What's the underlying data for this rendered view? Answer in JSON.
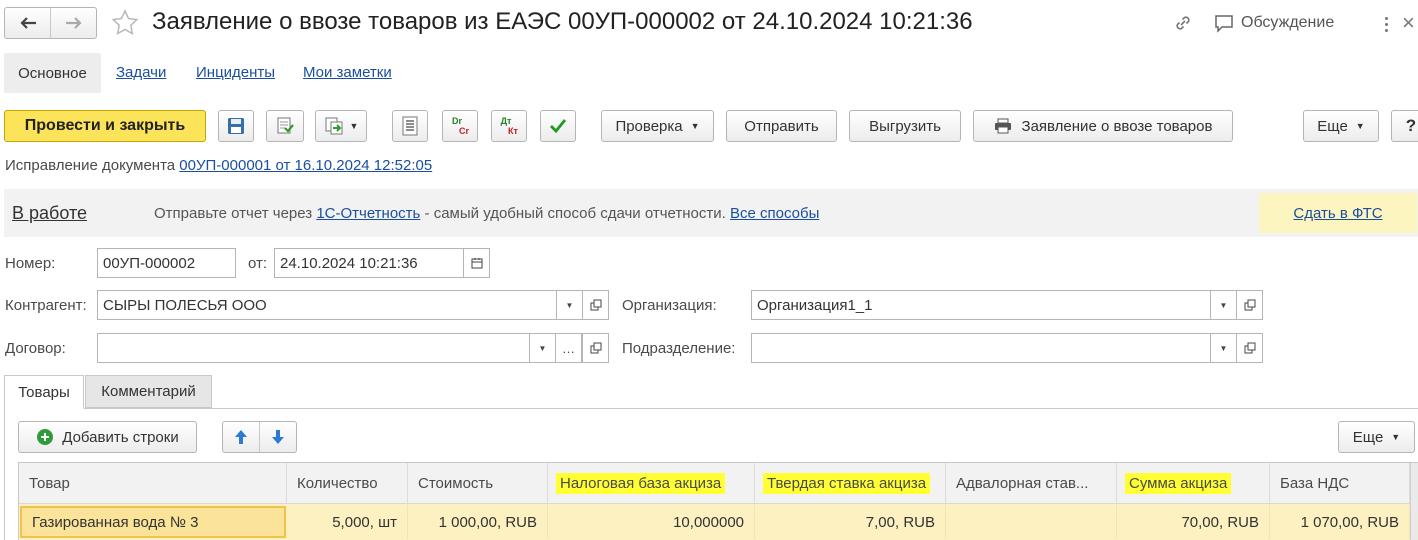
{
  "window": {
    "title": "Заявление о ввозе товаров из ЕАЭС 00УП-000002 от 24.10.2024 10:21:36",
    "discussion_label": "Обсуждение"
  },
  "nav_tabs": [
    {
      "label": "Основное"
    },
    {
      "label": "Задачи"
    },
    {
      "label": "Инциденты"
    },
    {
      "label": "Мои заметки"
    }
  ],
  "toolbar": {
    "post_close_label": "Провести и закрыть",
    "check_label": "Проверка",
    "send_label": "Отправить",
    "export_label": "Выгрузить",
    "print_label": "Заявление о ввозе товаров",
    "more_label": "Еще",
    "help_label": "?",
    "dt_kt_top": "Dr",
    "dt_kt_bottom": "Cr",
    "dt_kt2_top": "Дт",
    "dt_kt2_bottom": "Кт"
  },
  "correction": {
    "label": "Исправление документа",
    "link": "00УП-000001 от 16.10.2024 12:52:05"
  },
  "status_bar": {
    "status": "В работе",
    "message_prefix": "Отправьте отчет через",
    "service_link": "1С-Отчетность",
    "message_suffix": "- самый удобный способ сдачи отчетности.",
    "all_methods_link": "Все способы",
    "submit_link": "Сдать в ФТС"
  },
  "form": {
    "number_label": "Номер:",
    "number_value": "00УП-000002",
    "date_label": "от:",
    "date_value": "24.10.2024 10:21:36",
    "counterparty_label": "Контрагент:",
    "counterparty_value": "СЫРЫ ПОЛЕСЬЯ ООО",
    "organization_label": "Организация:",
    "organization_value": "Организация1_1",
    "contract_label": "Договор:",
    "contract_value": "",
    "subdivision_label": "Подразделение:",
    "subdivision_value": ""
  },
  "doc_tabs": [
    {
      "label": "Товары",
      "active": true
    },
    {
      "label": "Комментарий",
      "active": false
    }
  ],
  "table_toolbar": {
    "add_rows_label": "Добавить строки",
    "more_label": "Еще"
  },
  "table": {
    "columns": [
      {
        "label": "Товар",
        "highlighted": false
      },
      {
        "label": "Количество",
        "highlighted": false
      },
      {
        "label": "Стоимость",
        "highlighted": false
      },
      {
        "label": "Налоговая база акциза",
        "highlighted": true
      },
      {
        "label": "Твердая ставка акциза",
        "highlighted": true
      },
      {
        "label": "Адвалорная став...",
        "highlighted": false
      },
      {
        "label": "Сумма акциза",
        "highlighted": true
      },
      {
        "label": "База НДС",
        "highlighted": false
      }
    ],
    "rows": [
      [
        "Газированная вода № 3",
        "5,000, шт",
        "1 000,00, RUB",
        "10,000000",
        "7,00, RUB",
        "",
        "70,00, RUB",
        "1 070,00, RUB"
      ]
    ]
  },
  "colors": {
    "primary_button": "#fbe35a",
    "highlight": "#ffff33",
    "selected_row": "#fdf1c2",
    "link": "#1a4e9e",
    "status_bar_bg": "#f2f2f2",
    "submit_bg": "#fdf5c0"
  }
}
